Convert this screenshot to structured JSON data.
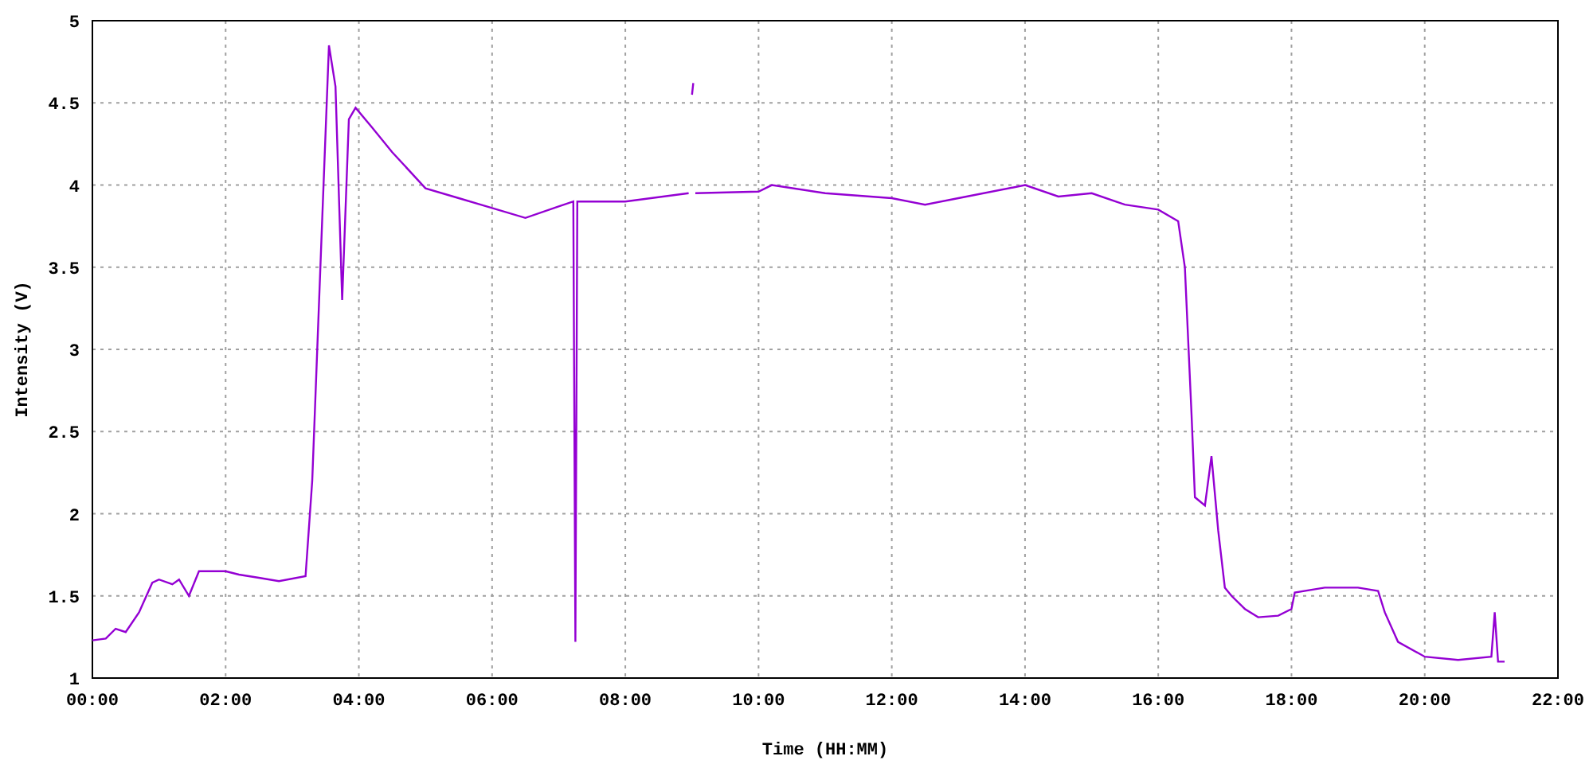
{
  "chart_data": {
    "type": "line",
    "xlabel": "Time (HH:MM)",
    "ylabel": "Intensity (V)",
    "x": [
      0,
      0.2,
      0.35,
      0.5,
      0.7,
      0.9,
      1.0,
      1.2,
      1.3,
      1.45,
      1.6,
      2.0,
      2.2,
      2.5,
      2.8,
      3.2,
      3.3,
      3.45,
      3.55,
      3.65,
      3.75,
      3.85,
      3.95,
      4.2,
      4.5,
      5.0,
      5.5,
      6.0,
      6.5,
      7.0,
      7.22,
      7.25,
      7.28,
      7.5,
      8.0,
      8.95,
      8.98,
      9.0,
      9.02,
      9.03,
      9.05,
      10.0,
      10.2,
      11.0,
      12.0,
      12.5,
      13.0,
      14.0,
      14.5,
      15.0,
      15.5,
      16.0,
      16.3,
      16.4,
      16.5,
      16.55,
      16.7,
      16.8,
      16.9,
      17.0,
      17.1,
      17.3,
      17.5,
      17.8,
      18.0,
      18.05,
      18.5,
      19.0,
      19.3,
      19.4,
      19.6,
      20.0,
      20.5,
      21.0,
      21.05,
      21.1,
      21.2
    ],
    "series": [
      {
        "color": "#9400d3",
        "values": [
          1.23,
          1.24,
          1.3,
          1.28,
          1.4,
          1.58,
          1.6,
          1.57,
          1.6,
          1.5,
          1.65,
          1.65,
          1.63,
          1.61,
          1.59,
          1.62,
          2.2,
          3.8,
          4.85,
          4.6,
          3.3,
          4.4,
          4.47,
          4.35,
          4.2,
          3.98,
          3.92,
          3.86,
          3.8,
          3.87,
          3.9,
          1.22,
          3.9,
          3.9,
          3.9,
          3.95,
          null,
          4.55,
          4.62,
          null,
          3.95,
          3.96,
          4.0,
          3.95,
          3.92,
          3.88,
          3.92,
          4.0,
          3.93,
          3.95,
          3.88,
          3.85,
          3.78,
          3.5,
          2.6,
          2.1,
          2.05,
          2.35,
          1.9,
          1.55,
          1.5,
          1.42,
          1.37,
          1.38,
          1.42,
          1.52,
          1.55,
          1.55,
          1.53,
          1.4,
          1.22,
          1.13,
          1.11,
          1.13,
          1.4,
          1.1,
          1.1
        ]
      }
    ],
    "grid": true,
    "xlim": [
      0,
      22
    ],
    "ylim": [
      1,
      5
    ],
    "xticks": [
      {
        "value": 0,
        "label": "00:00"
      },
      {
        "value": 2,
        "label": "02:00"
      },
      {
        "value": 4,
        "label": "04:00"
      },
      {
        "value": 6,
        "label": "06:00"
      },
      {
        "value": 8,
        "label": "08:00"
      },
      {
        "value": 10,
        "label": "10:00"
      },
      {
        "value": 12,
        "label": "12:00"
      },
      {
        "value": 14,
        "label": "14:00"
      },
      {
        "value": 16,
        "label": "16:00"
      },
      {
        "value": 18,
        "label": "18:00"
      },
      {
        "value": 20,
        "label": "20:00"
      },
      {
        "value": 22,
        "label": "22:00"
      }
    ],
    "yticks": [
      1,
      1.5,
      2,
      2.5,
      3,
      3.5,
      4,
      4.5,
      5
    ]
  }
}
